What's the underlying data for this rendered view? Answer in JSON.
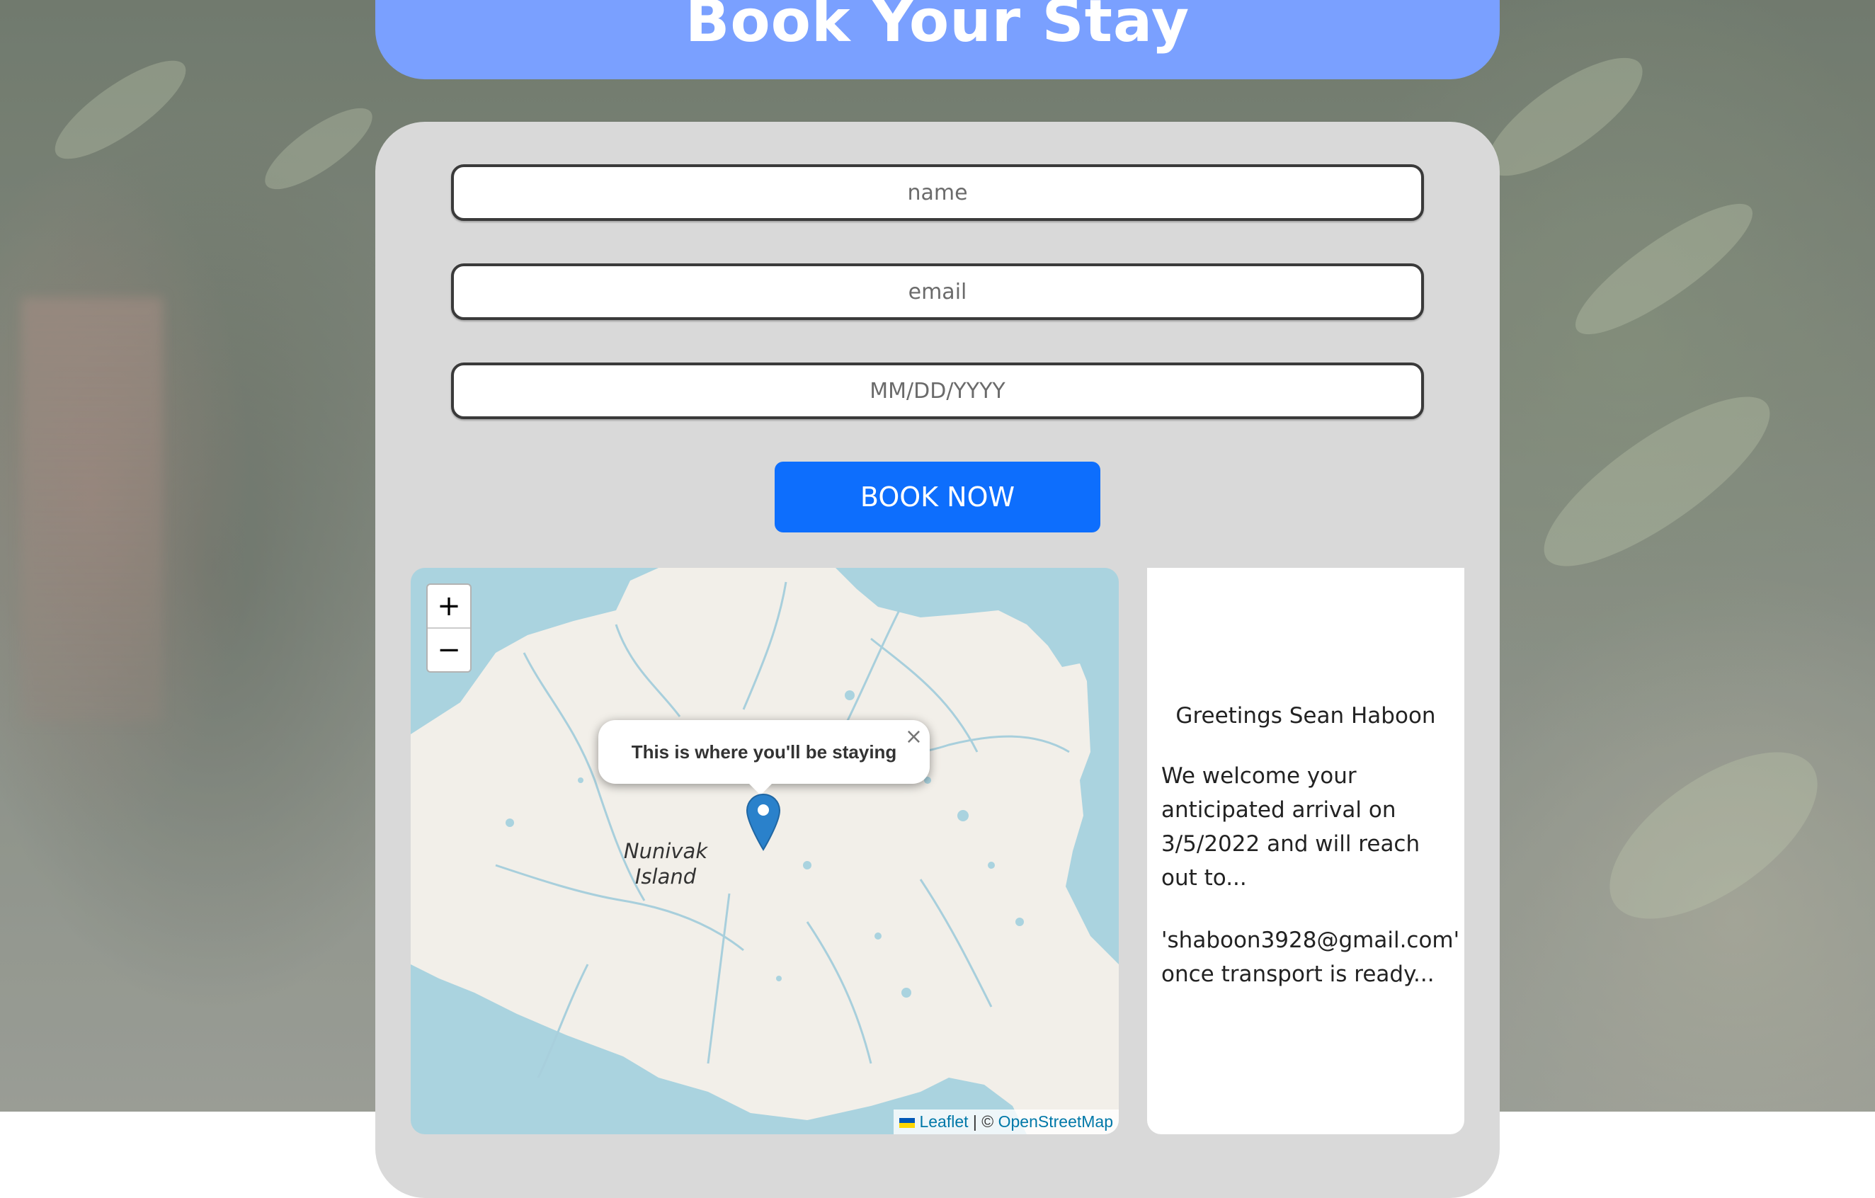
{
  "header": {
    "title": "Book Your Stay"
  },
  "form": {
    "name_placeholder": "name",
    "email_placeholder": "email",
    "date_placeholder": "MM/DD/YYYY",
    "submit_label": "BOOK NOW"
  },
  "map": {
    "zoom_in": "+",
    "zoom_out": "−",
    "popup_text": "This is where you'll be staying",
    "popup_close": "×",
    "place_label_line1": "Nunivak",
    "place_label_line2": "Island",
    "attribution_leaflet": "Leaflet",
    "attribution_sep": " | © ",
    "attribution_osm": "OpenStreetMap"
  },
  "info": {
    "greeting": "Greetings Sean Haboon",
    "message": "We welcome your anticipated arrival on 3/5/2022 and will reach out to...",
    "email_line": "'shaboon3928@gmail.com' once transport is ready..."
  },
  "colors": {
    "title_bar": "#7aa0ff",
    "card": "#d9d9d9",
    "button": "#0d6efd",
    "water": "#aad3df",
    "land": "#f2efe9",
    "marker": "#2a81cb"
  }
}
